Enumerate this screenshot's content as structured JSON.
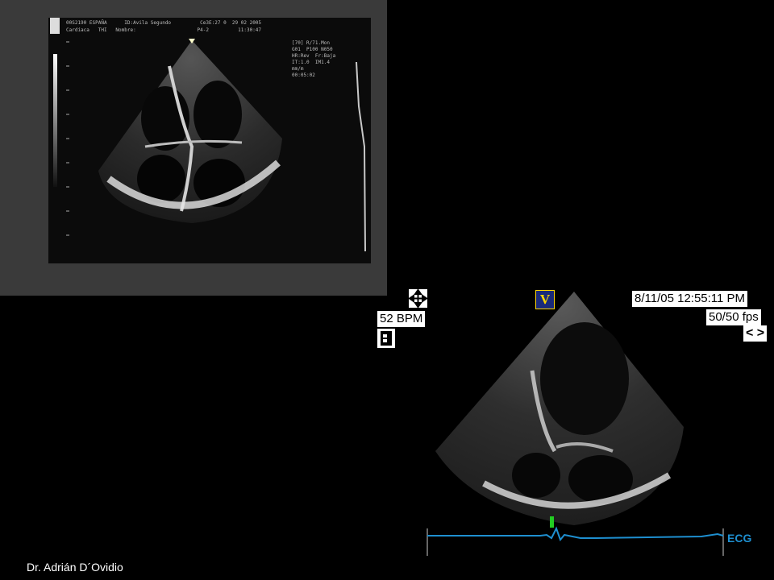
{
  "top_image": {
    "header_line1": "00S2190 ESPAÑA      ID:Avila Segundo          Ce3E:27 0  29 02 2005",
    "header_line2": "Cardíaca   THI   Nombre:                     P4-2          11:30:47",
    "settings": [
      "[70] R/71.Mon",
      "G01  P100 N050",
      "HR:Rev  Fr:Baja",
      "IT:1.0  IM1.4",
      "mm/m",
      "00:05:02"
    ]
  },
  "bottom_image": {
    "bpm": "52 BPM",
    "datetime": "8/11/05 12:55:11 PM",
    "fps": "50/50 fps",
    "nav": "<  >",
    "v_badge": "V",
    "ecg_label": "ECG"
  },
  "credit": "Dr. Adrián D´Ovidio"
}
